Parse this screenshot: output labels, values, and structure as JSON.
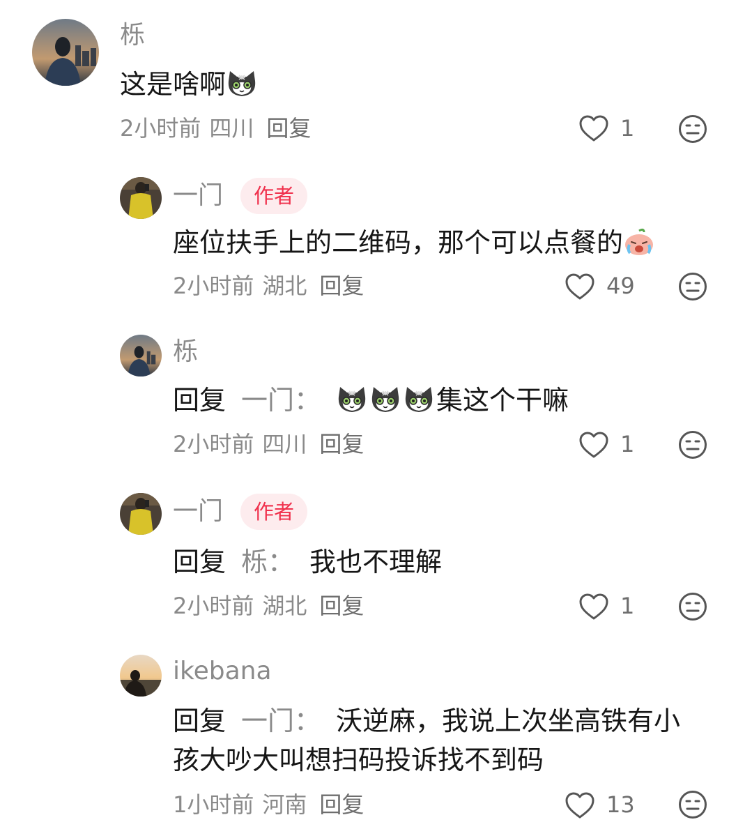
{
  "comments": [
    {
      "username": "栎",
      "text_before": "这是啥啊",
      "emoji_count": 1,
      "time": "2小时前",
      "location": "四川",
      "reply_label": "回复",
      "likes": "1"
    },
    {
      "username": "一门",
      "badge": "作者",
      "text": "座位扶手上的二维码，那个可以点餐的",
      "time": "2小时前",
      "location": "湖北",
      "reply_label": "回复",
      "likes": "49"
    },
    {
      "username": "栎",
      "reply_word": "回复",
      "target": "一门",
      "colon": "：",
      "text_after": "集这个干嘛",
      "emoji_count": 3,
      "time": "2小时前",
      "location": "四川",
      "reply_label": "回复",
      "likes": "1"
    },
    {
      "username": "一门",
      "badge": "作者",
      "reply_word": "回复",
      "target": "栎",
      "colon": "：",
      "text_after": "我也不理解",
      "time": "2小时前",
      "location": "湖北",
      "reply_label": "回复",
      "likes": "1"
    },
    {
      "username": "ikebana",
      "reply_word": "回复",
      "target": "一门",
      "colon": "：",
      "text_line1": "沃逆麻，我说上次坐高铁有小",
      "text_line2": "孩大吵大叫想扫码投诉找不到码",
      "time": "1小时前",
      "location": "河南",
      "reply_label": "回复",
      "likes": "13"
    }
  ],
  "colors": {
    "username": "#8a8a8a",
    "badge_bg": "#fdecee",
    "badge_text": "#f0304c",
    "text": "#161616",
    "meta": "#8a8a8a"
  },
  "icons": {
    "like": "heart-outline-icon",
    "dislike": "meh-face-icon",
    "cat_emoji": "cat-emoji",
    "crying_emoji": "peach-crying-emoji"
  }
}
